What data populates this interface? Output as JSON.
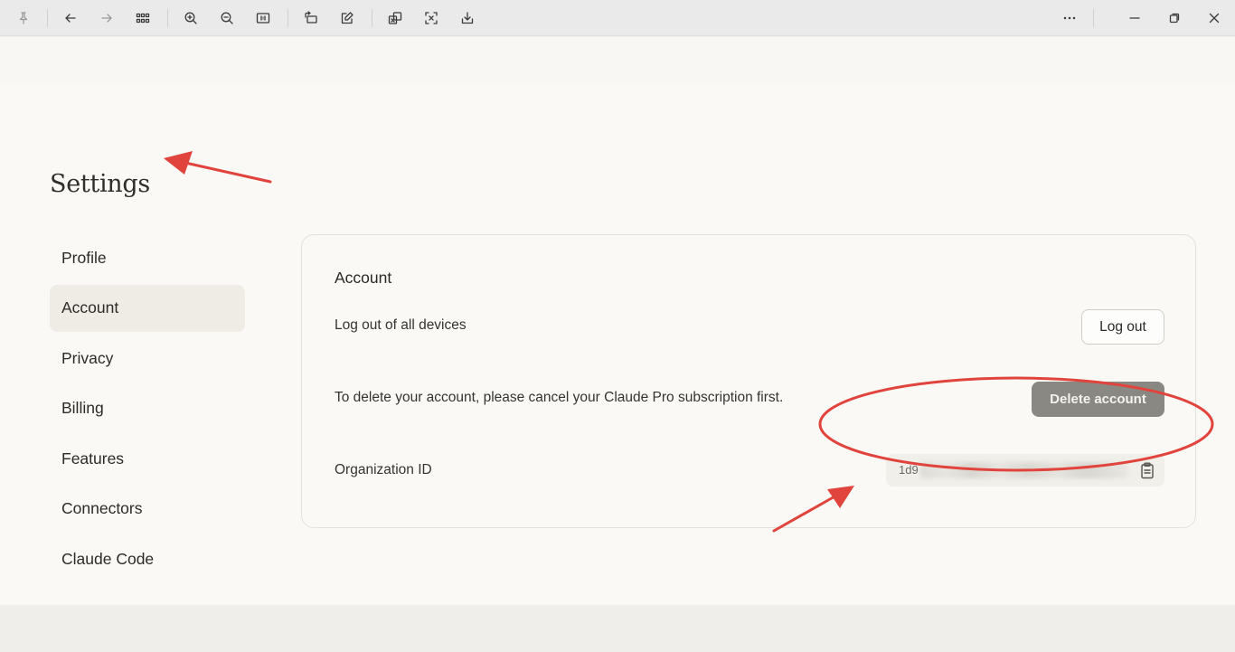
{
  "viewer": {
    "toolbar": {
      "left_icons": [
        "pin-icon",
        "back-arrow-icon",
        "forward-arrow-icon",
        "grid-view-icon",
        "zoom-in-icon",
        "zoom-out-icon",
        "actual-size-icon",
        "rotate-icon",
        "edit-icon",
        "compare-icon",
        "crop-icon",
        "save-icon"
      ],
      "right_icons": [
        "more-icon",
        "minimize-icon",
        "restore-icon",
        "close-icon"
      ]
    }
  },
  "settings": {
    "title": "Settings",
    "nav": [
      {
        "label": "Profile",
        "active": false
      },
      {
        "label": "Account",
        "active": true
      },
      {
        "label": "Privacy",
        "active": false
      },
      {
        "label": "Billing",
        "active": false
      },
      {
        "label": "Features",
        "active": false
      },
      {
        "label": "Connectors",
        "active": false
      },
      {
        "label": "Claude Code",
        "active": false
      }
    ],
    "account": {
      "title": "Account",
      "logout_label": "Log out of all devices",
      "logout_button": "Log out",
      "delete_label": "To delete your account, please cancel your Claude Pro subscription first.",
      "delete_button": "Delete account",
      "org_label": "Organization ID",
      "org_id_visible_prefix": "1d9",
      "org_id_redacted": true
    }
  },
  "colors": {
    "annotation": "#e0443c",
    "delete_button_bg": "#8a8883",
    "active_nav_bg": "#eeece4"
  }
}
